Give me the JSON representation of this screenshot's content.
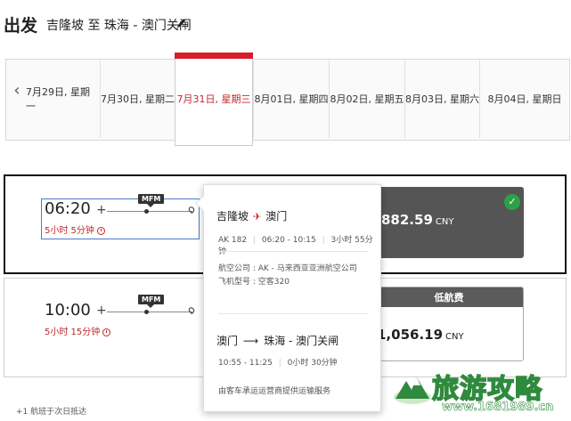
{
  "header": {
    "title": "出发",
    "route": "吉隆坡 至 珠海 - 澳门关闸"
  },
  "dates": [
    {
      "label": "7月29日, 星期一"
    },
    {
      "label": "7月30日, 星期二"
    },
    {
      "label": "7月31日, 星期三"
    },
    {
      "label": "8月01日, 星期四"
    },
    {
      "label": "8月02日, 星期五"
    },
    {
      "label": "8月03日, 星期六"
    },
    {
      "label": "8月04日, 星期日"
    }
  ],
  "nav": {
    "prev": "‹"
  },
  "flights": [
    {
      "depart": "06:20",
      "duration": "5小时 5分钟",
      "stop": "MFM",
      "price": "882.59",
      "currency": "CNY",
      "selected": true
    },
    {
      "depart": "10:00",
      "duration": "5小时 15分钟",
      "stop": "MFM",
      "price": "1,056.19",
      "currency": "CNY",
      "fare_label": "低航费"
    }
  ],
  "popup": {
    "leg1_from": "吉隆坡",
    "leg1_to": "澳门",
    "leg1_flight": "AK 182",
    "leg1_time": "06:20 - 10:15",
    "leg1_duration": "3小时 55分钟",
    "airline": "航空公司 : AK - 马来西亚亚洲航空公司",
    "aircraft": "飞机型号 : 空客320",
    "leg2_from": "澳门",
    "leg2_arrow": "⟶",
    "leg2_to": "珠海 - 澳门关闸",
    "leg2_time": "10:55 - 11:25",
    "leg2_duration": "0小时 30分钟",
    "leg2_note": "由客车承运运营商提供运输服务"
  },
  "footnote": "+1 航班于次日抵达",
  "watermark": {
    "text": "旅游攻略",
    "url": "www.1681989.cn"
  },
  "colors": {
    "accent": "#d71c2a",
    "duration_red": "#c0282d",
    "check_green": "#2aa24a",
    "fare_dark": "#555555"
  },
  "icons": {
    "edit": "pencil-icon",
    "plane": "airplane-icon",
    "check": "check-circle-icon",
    "clock": "clock-icon"
  }
}
